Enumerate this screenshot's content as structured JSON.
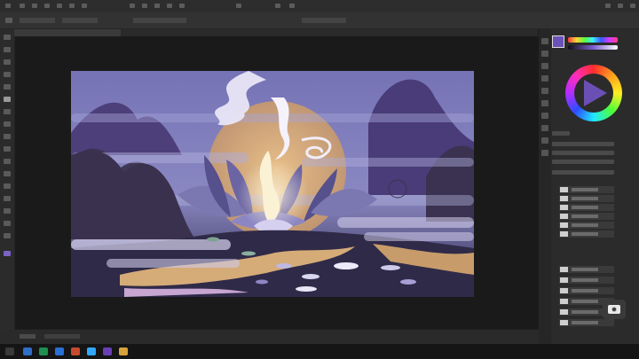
{
  "app": {
    "accent": "#6b52b8"
  },
  "menus": [],
  "status": {},
  "canvas": {
    "background_top": "#7b78b6",
    "background_bottom": "#2e2a4e",
    "moon_color": "#e7b872"
  },
  "icons": {
    "tools": [
      "move-tool-icon",
      "marquee-tool-icon",
      "lasso-tool-icon",
      "crop-tool-icon",
      "eyedropper-tool-icon",
      "brush-tool-icon",
      "stamp-tool-icon",
      "eraser-tool-icon",
      "gradient-tool-icon",
      "blur-tool-icon",
      "dodge-tool-icon",
      "pen-tool-icon",
      "type-tool-icon",
      "path-select-icon",
      "shape-tool-icon",
      "hand-tool-icon",
      "zoom-tool-icon"
    ],
    "camera": "camera-icon"
  }
}
